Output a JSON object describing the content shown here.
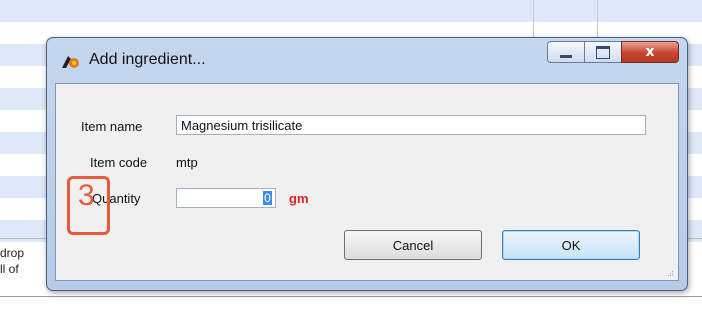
{
  "dialog": {
    "title": "Add ingredient...",
    "close_glyph": "x",
    "fields": {
      "item_name_label": "Item name",
      "item_name_value": "Magnesium trisilicate",
      "item_code_label": "Item code",
      "item_code_value": "mtp",
      "quantity_label_first": "Q",
      "quantity_label_rest": "uantity",
      "quantity_value": "0",
      "quantity_unit": "gm"
    },
    "buttons": {
      "cancel": "Cancel",
      "ok": "OK"
    }
  },
  "annotation": {
    "step_number": "3"
  },
  "background": {
    "cut_text_line1": "drop",
    "cut_text_line2": "ll of"
  },
  "colors": {
    "unit_text": "#e02020",
    "annotation": "#e8593c",
    "selection": "#3e8de0"
  },
  "icons": [
    "app-icon",
    "minimize-icon",
    "maximize-icon",
    "close-icon",
    "resize-grip-icon"
  ]
}
